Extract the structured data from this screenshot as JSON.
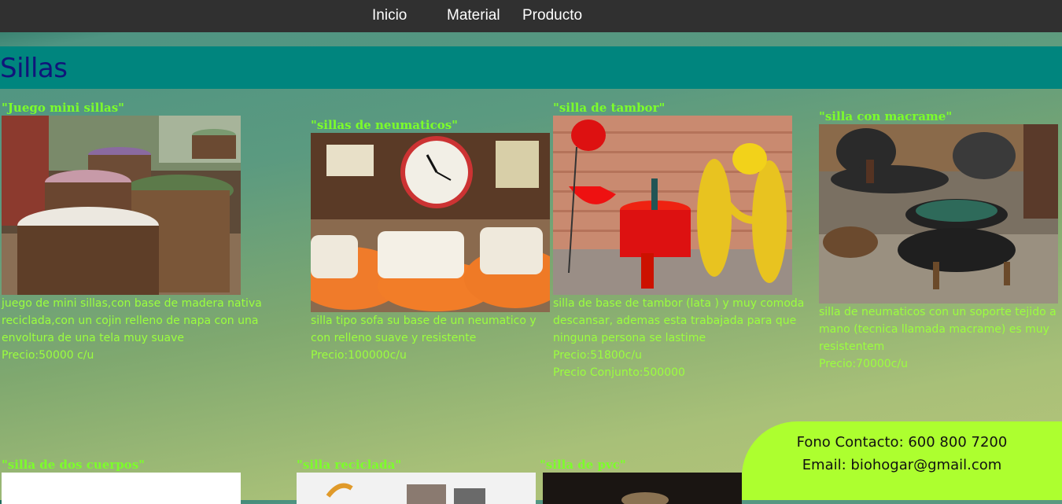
{
  "nav": {
    "items": [
      {
        "label": "Inicio"
      },
      {
        "label": "Material"
      },
      {
        "label": "Producto"
      }
    ]
  },
  "page": {
    "title": "Sillas"
  },
  "products": [
    {
      "title": "\"Juego mini sillas\"",
      "desc": "juego de mini sillas,con base de madera nativa reciclada,con un cojin relleno de napa con una envoltura de una tela muy suave",
      "price": "Precio:50000 c/u"
    },
    {
      "title": "\"sillas de neumaticos\"",
      "desc": "silla tipo sofa su base de un neumatico y con relleno suave y resistente",
      "price": "Precio:100000c/u"
    },
    {
      "title": "\"silla de tambor\"",
      "desc": "silla de base de tambor (lata ) y muy comoda descansar, ademas esta trabajada para que ninguna persona se lastime",
      "price": "Precio:51800c/u",
      "price2": "Precio Conjunto:500000"
    },
    {
      "title": "\"silla con macrame\"",
      "desc": "silla de neumaticos con un soporte tejido a mano (tecnica llamada macrame) es muy resistentem",
      "price": "Precio:70000c/u"
    },
    {
      "title": "\"silla de dos cuerpos\""
    },
    {
      "title": "\"silla reciclada\""
    },
    {
      "title": "\"silla de pvc\""
    }
  ],
  "contact": {
    "phone": "Fono Contacto: 600 800 7200",
    "email": "Email: biohogar@gmail.com"
  },
  "colors": {
    "navbar": "#303030",
    "banner": "#00857e",
    "title": "#10157a",
    "product_text": "#9bff3e",
    "contact_bg": "#adff2f"
  }
}
